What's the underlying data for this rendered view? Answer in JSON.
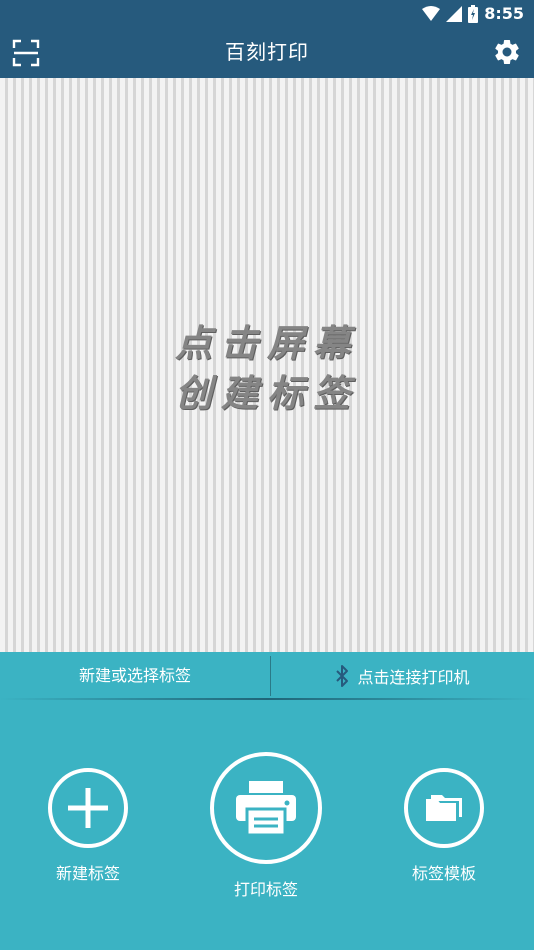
{
  "status_bar": {
    "time": "8:55"
  },
  "app_bar": {
    "title": "百刻打印",
    "scan_icon": "scan-frame-icon",
    "settings_icon": "gear-icon"
  },
  "canvas": {
    "hint_line1": "点击屏幕",
    "hint_line2": "创建标签"
  },
  "mid_bar": {
    "left_label": "新建或选择标签",
    "right_label": "点击连接打印机",
    "right_icon": "bluetooth-icon"
  },
  "actions": {
    "new_label": "新建标签",
    "print_label": "打印标签",
    "template_label": "标签模板"
  },
  "colors": {
    "header": "#265a7d",
    "accent": "#3bb3c3"
  }
}
